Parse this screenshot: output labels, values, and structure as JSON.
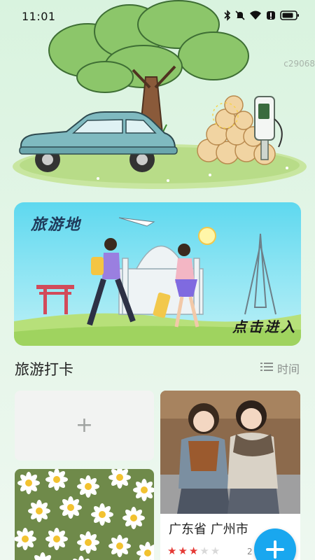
{
  "status_bar": {
    "time": "11:01",
    "icons": [
      "bluetooth-icon",
      "mute-icon",
      "wifi-icon",
      "alert-icon",
      "battery-icon"
    ]
  },
  "watermark": "c29068",
  "banner": {
    "title": "旅游地",
    "cta": "点击进入"
  },
  "section": {
    "title": "旅游打卡",
    "sort_label": "时间"
  },
  "cards": {
    "add": {
      "symbol": "+"
    },
    "photo": {
      "place": "广东省 广州市",
      "rating": 3,
      "max_rating": 5,
      "count_text": "2"
    }
  },
  "colors": {
    "accent": "#19a7ef",
    "star_on": "#e53935",
    "star_off": "#d9d9d9"
  }
}
